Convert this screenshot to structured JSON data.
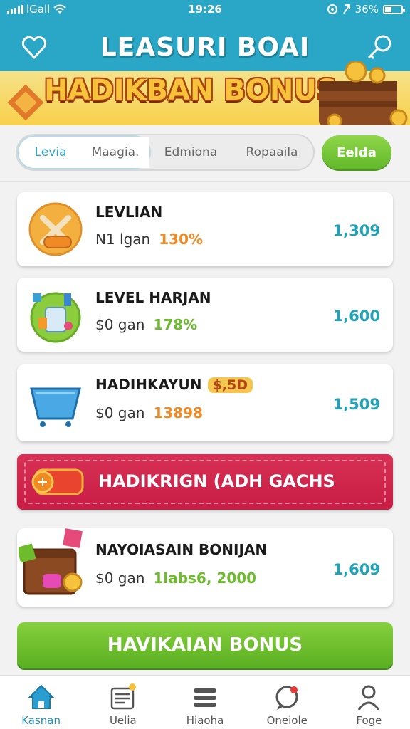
{
  "status": {
    "carrier": "lGall",
    "time": "19:26",
    "battery": "36%",
    "battery_level": 0.36
  },
  "header": {
    "title": "LEASURI BOAI",
    "bonus_text": "HADIKBAN BONUS"
  },
  "tabs": [
    "Levia",
    "Maagia.",
    "Edmiona",
    "Ropaaila"
  ],
  "action_button": "Eelda",
  "rows": [
    {
      "name": "LEVLIAN",
      "sub": "N1 lgan",
      "pct": "130%",
      "amount": "1,309",
      "pct_color": "#f08a24"
    },
    {
      "name": "LEVEL HARJAN",
      "sub": "$0 gan",
      "pct": "178%",
      "amount": "1,600",
      "pct_color": "#6cbc2b"
    },
    {
      "name": "HADIHKAYUN",
      "badge": "$,5D",
      "sub": "$0 gan",
      "pct": "13898",
      "amount": "1,509",
      "pct_color": "#f08a24"
    }
  ],
  "banner": {
    "label": "HADIKRIGN (ADH GACHS"
  },
  "row4": {
    "name": "NAYOIASAIN BONIJAN",
    "sub": "$0 gan",
    "pct": "1labs6, 2000",
    "amount": "1,609",
    "pct_color": "#6cbc2b"
  },
  "main_button": "HAVIKAIAN BONUS",
  "nav": [
    {
      "label": "Kasnan",
      "icon": "home-icon"
    },
    {
      "label": "Uelia",
      "icon": "list-icon"
    },
    {
      "label": "Hiaoha",
      "icon": "menu-icon"
    },
    {
      "label": "Oneiole",
      "icon": "chat-icon"
    },
    {
      "label": "Foge",
      "icon": "profile-icon"
    }
  ],
  "colors": {
    "accent": "#2aa7c6",
    "green": "#6cbc2b",
    "red": "#c81c44",
    "amount": "#21a3b7"
  }
}
